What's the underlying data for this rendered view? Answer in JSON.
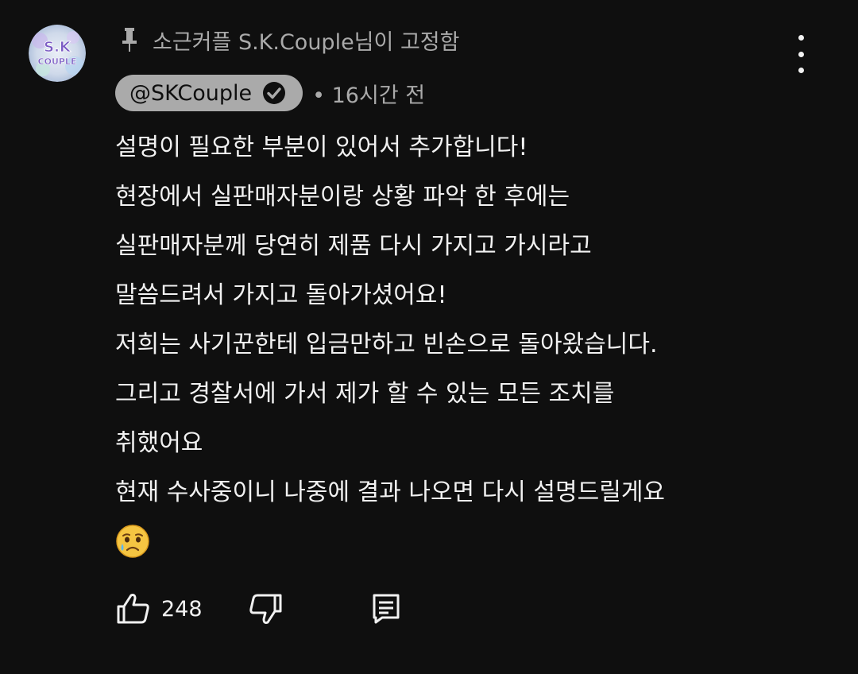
{
  "comment": {
    "pinned_text": "소근커플 S.K.Couple님이 고정함",
    "avatar_text_top": "S.K",
    "avatar_text_bottom": "COUPLE",
    "author_handle": "@SKCouple",
    "timestamp": "• 16시간 전",
    "body_lines": [
      "설명이 필요한 부분이 있어서 추가합니다!",
      "현장에서 실판매자분이랑 상황 파악 한 후에는",
      "실판매자분께 당연히 제품 다시 가지고 가시라고",
      "말씀드려서 가지고 돌아가셨어요!",
      "저희는 사기꾼한테 입금만하고 빈손으로 돌아왔습니다.",
      "그리고 경찰서에 가서 제가 할 수 있는 모든 조치를",
      "취했어요",
      "현재 수사중이니 나중에 결과 나오면 다시 설명드릴게요"
    ],
    "body_emoji": "crying-face-icon",
    "like_count": "248"
  },
  "icons": {
    "pin": "pin-icon",
    "verified": "verified-check-icon",
    "more": "more-vertical-icon",
    "like": "thumbs-up-icon",
    "dislike": "thumbs-down-icon",
    "reply": "reply-comment-icon"
  },
  "colors": {
    "background": "#0f0f0f",
    "text_primary": "#f1f1f1",
    "text_secondary": "#aaaaaa",
    "author_chip_bg": "#aaaaaa",
    "avatar_purple": "#7b5cc4"
  }
}
